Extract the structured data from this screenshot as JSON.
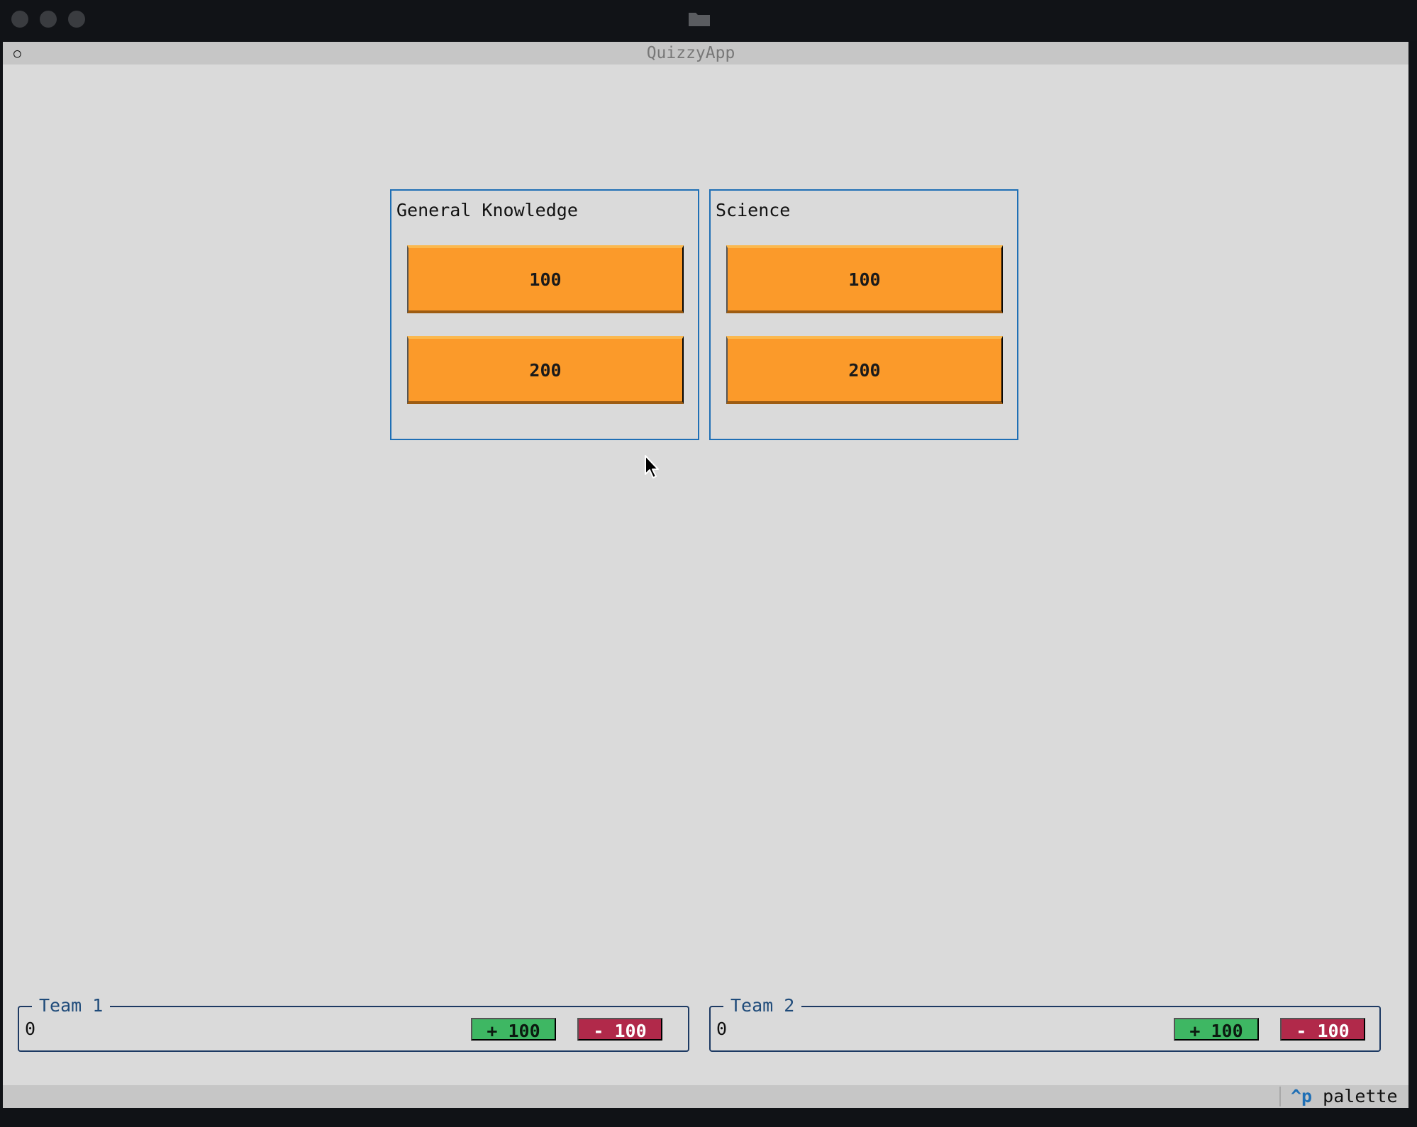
{
  "app": {
    "title": "QuizzyApp",
    "header_icon": "○"
  },
  "categories": [
    {
      "title": "General Knowledge",
      "buttons": [
        "100",
        "200"
      ]
    },
    {
      "title": "Science",
      "buttons": [
        "100",
        "200"
      ]
    }
  ],
  "teams": [
    {
      "name": "Team 1",
      "score": "0",
      "plus_label": "+ 100",
      "minus_label": "- 100"
    },
    {
      "name": "Team 2",
      "score": "0",
      "plus_label": "+ 100",
      "minus_label": "- 100"
    }
  ],
  "footer": {
    "key": "^p",
    "label": "palette"
  },
  "colors": {
    "accent": "#1f6fb5",
    "question_button": "#fb9a2a",
    "plus_button": "#3eb763",
    "minus_button": "#b1294a",
    "background": "#dadada"
  },
  "icons": [
    "folder-icon",
    "circle-icon",
    "mouse-cursor-icon"
  ]
}
